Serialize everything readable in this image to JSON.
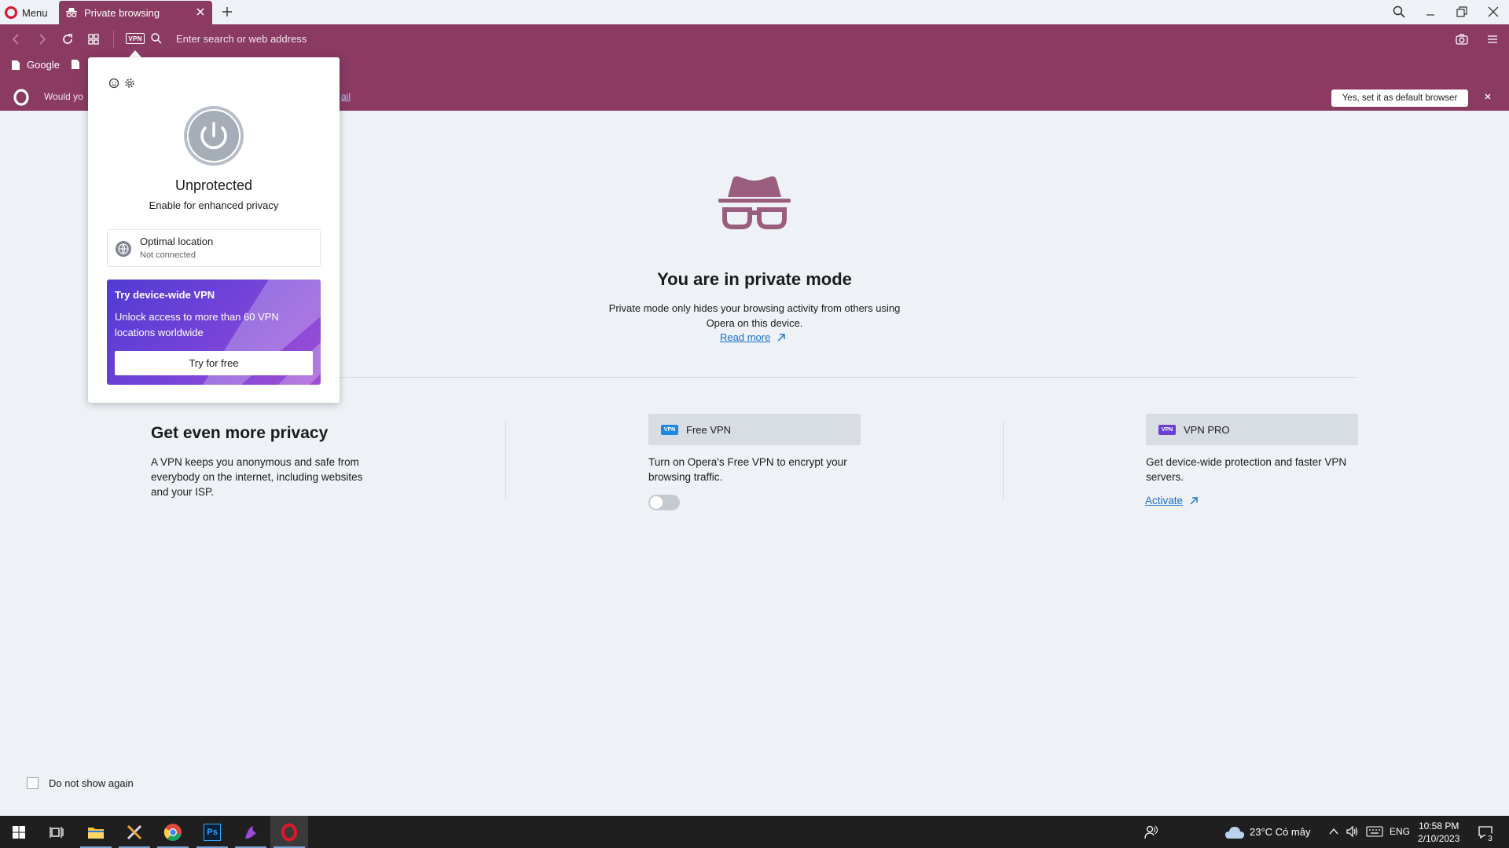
{
  "browser": {
    "menu_label": "Menu",
    "tab_title": "Private browsing",
    "address_placeholder": "Enter search or web address",
    "vpn_badge": "VPN",
    "bookmarks": [
      {
        "label": "Google"
      }
    ]
  },
  "notice": {
    "text_partial": "Would yo",
    "link_partial": "ail",
    "default_button": "Yes, set it as default browser"
  },
  "vpn_popup": {
    "status_title": "Unprotected",
    "status_subtitle": "Enable for enhanced privacy",
    "location_title": "Optimal location",
    "location_status": "Not connected",
    "promo_title": "Try device-wide VPN",
    "promo_desc": "Unlock access to more than 60 VPN locations worldwide",
    "promo_button": "Try for free"
  },
  "page": {
    "title": "You are in private mode",
    "description": "Private mode only hides your browsing activity from others using Opera on this device.",
    "read_more": "Read more",
    "privacy_title": "Get even more privacy",
    "privacy_desc": "A VPN keeps you anonymous and safe from everybody on the internet, including websites and your ISP.",
    "free_vpn": {
      "label": "Free VPN",
      "badge": "VPN",
      "desc": "Turn on Opera's Free VPN to encrypt your browsing traffic.",
      "toggle_on": false
    },
    "vpn_pro": {
      "label": "VPN PRO",
      "badge": "VPN",
      "desc": "Get device-wide protection and faster VPN servers.",
      "activate": "Activate"
    },
    "dont_show": "Do not show again"
  },
  "taskbar": {
    "weather": "23°C  Có mây",
    "language": "ENG",
    "time": "10:58 PM",
    "date": "2/10/2023",
    "notification_count": "3",
    "ps_label": "Ps"
  },
  "colors": {
    "accent": "#8b3a62",
    "promo_start": "#4f3bd3",
    "promo_end": "#a04fd6",
    "link": "#1b6fd0"
  }
}
